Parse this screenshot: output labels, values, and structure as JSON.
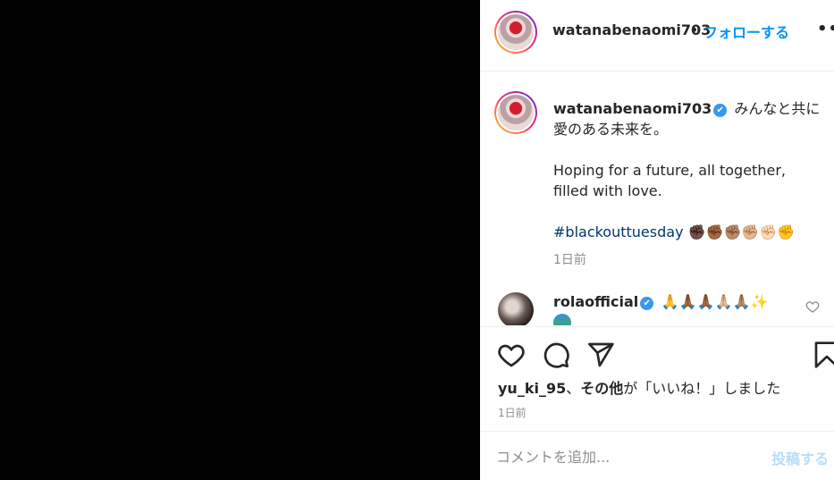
{
  "header": {
    "username": "watanabenaomi703",
    "separator": "•",
    "follow_label": "フォローする",
    "more_label": "•••"
  },
  "caption": {
    "username": "watanabenaomi703",
    "verified_icon": "✔",
    "line1": "みんなと共に",
    "line2": "愛のある未来を。",
    "english": "Hoping for a future, all together, filled with love.",
    "hashtag": "#blackouttuesday",
    "fists": "✊🏿✊🏾✊🏽✊🏼✊🏻✊",
    "time": "1日前"
  },
  "comment": {
    "username": "rolaofficial",
    "verified_icon": "✔",
    "emojis": "🙏🙏🏾🙏🏾🙏🏼🙏🏽✨",
    "icons": [
      "heart-outline-icon"
    ]
  },
  "actions": {
    "icons": [
      "heart-icon",
      "comment-icon",
      "share-icon",
      "bookmark-icon"
    ]
  },
  "likes": {
    "user": "yu_ki_95",
    "sep": "、",
    "others": "その他",
    "suffix": "が「いいね！」しました"
  },
  "post_time": "1日前",
  "add_comment": {
    "placeholder": "コメントを追加...",
    "post_label": "投稿する"
  },
  "colors": {
    "accent": "#0095f6",
    "post_disabled": "#b2dffc",
    "hashtag": "#00376b",
    "verified": "#3897f0",
    "muted": "#8e8e8e"
  }
}
